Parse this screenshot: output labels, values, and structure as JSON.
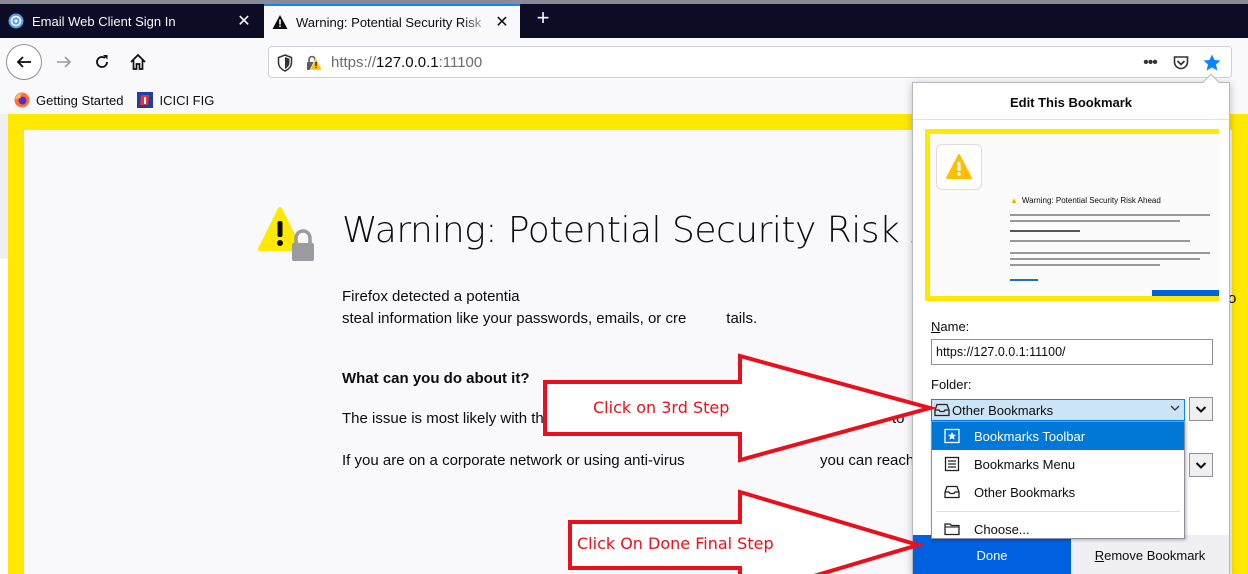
{
  "tabs": [
    {
      "title": "Email Web Client Sign In",
      "close": "✕"
    },
    {
      "title": "Warning: Potential Security Risk",
      "close": "✕"
    }
  ],
  "new_tab": "+",
  "urlbar": {
    "scheme_host": "https://",
    "host": "127.0.0.1",
    "port": ":11100",
    "more": "•••"
  },
  "bookmarks_toolbar": [
    {
      "label": "Getting Started",
      "icon": "firefox-icon"
    },
    {
      "label": "ICICI FIG",
      "icon": "icici-icon"
    }
  ],
  "page": {
    "title": "Warning: Potential Security Risk Ahea",
    "detected_text_line1": "Firefox detected a potentia",
    "detected_text_line2": "steal information like your passwords, emails, or cre",
    "detected_tail": "tails.",
    "right_edge": "o",
    "what_heading": "What can you do about it?",
    "issue_text": "The issue is most likely with th",
    "issue_tail": "to",
    "corporate_text": "If you are on a corporate network or using anti-virus",
    "corporate_tail": "you can reach out to the support teams for assistance"
  },
  "panel": {
    "title": "Edit This Bookmark",
    "preview_title": "Warning: Potential Security Risk Ahead",
    "name_label_u": "N",
    "name_label_rest": "ame:",
    "name_value": "https://127.0.0.1:11100/",
    "folder_label": "Folder:",
    "folder_selected": "Other Bookmarks",
    "folder_options": [
      {
        "label": "Bookmarks Toolbar",
        "icon": "bookmarks-toolbar-icon"
      },
      {
        "label": "Bookmarks Menu",
        "icon": "bookmarks-menu-icon"
      },
      {
        "label": "Other Bookmarks",
        "icon": "other-bookmarks-icon"
      },
      {
        "label": "Choose...",
        "icon": "folder-icon"
      }
    ],
    "done_label": "Done",
    "remove_u": "R",
    "remove_rest": "emove Bookmark"
  },
  "annotations": {
    "step3": "Click on 3rd Step",
    "final": "Click On Done Final Step",
    "color": "#e8101c"
  },
  "colors": {
    "accent": "#0060df",
    "warning_yellow": "#ffe900",
    "tab_bar": "#0c0c26"
  }
}
